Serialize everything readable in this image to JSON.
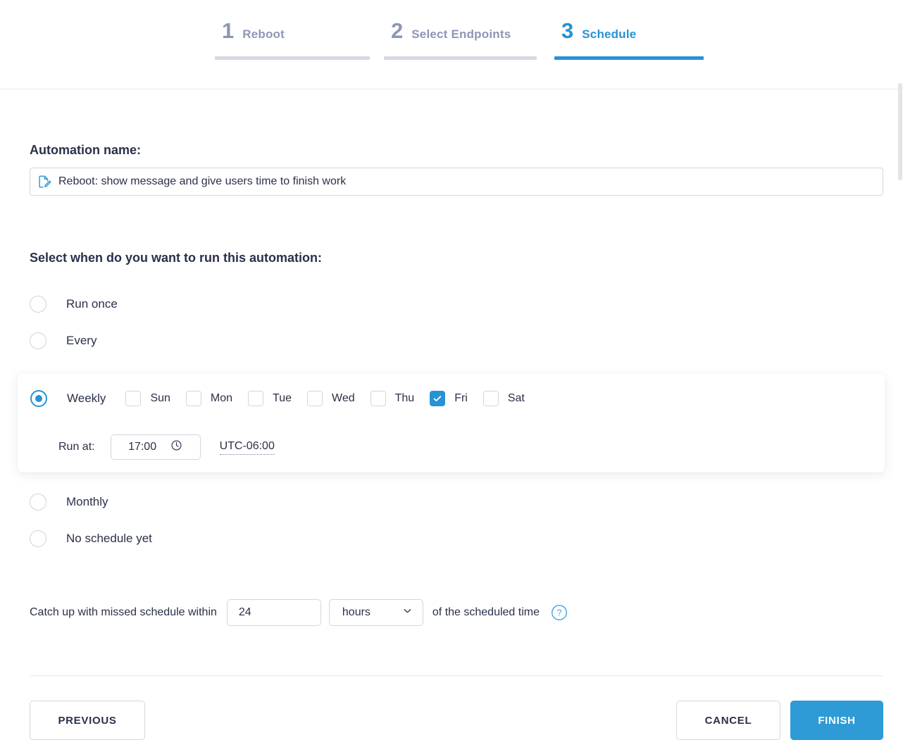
{
  "stepper": {
    "steps": [
      {
        "num": "1",
        "label": "Reboot",
        "state": "done"
      },
      {
        "num": "2",
        "label": "Select Endpoints",
        "state": "done"
      },
      {
        "num": "3",
        "label": "Schedule",
        "state": "active"
      }
    ],
    "active_color": "#2693d4",
    "inactive_color": "#8e96b4"
  },
  "form": {
    "name_label": "Automation name:",
    "name_value": "Reboot: show message and give users time to finish work",
    "name_icon": "document-edit-icon",
    "section_title": "Select when do you want to run this automation:"
  },
  "schedule": {
    "options": [
      {
        "key": "run_once",
        "label": "Run once",
        "selected": false
      },
      {
        "key": "every",
        "label": "Every",
        "selected": false
      },
      {
        "key": "weekly",
        "label": "Weekly",
        "selected": true
      },
      {
        "key": "monthly",
        "label": "Monthly",
        "selected": false
      },
      {
        "key": "no_schedule",
        "label": "No schedule yet",
        "selected": false
      }
    ],
    "weekly": {
      "label": "Weekly",
      "days": [
        {
          "label": "Sun",
          "checked": false
        },
        {
          "label": "Mon",
          "checked": false
        },
        {
          "label": "Tue",
          "checked": false
        },
        {
          "label": "Wed",
          "checked": false
        },
        {
          "label": "Thu",
          "checked": false
        },
        {
          "label": "Fri",
          "checked": true
        },
        {
          "label": "Sat",
          "checked": false
        }
      ],
      "run_at_label": "Run at:",
      "run_at_value": "17:00",
      "clock_icon": "clock-icon",
      "timezone": "UTC-06:00"
    }
  },
  "catchup": {
    "text_before": "Catch up with missed schedule within",
    "value": "24",
    "unit": "hours",
    "text_after": "of the scheduled time",
    "help_icon": "question-mark-icon"
  },
  "footer": {
    "previous": "PREVIOUS",
    "cancel": "CANCEL",
    "finish": "FINISH"
  },
  "colors": {
    "accent": "#2693d4",
    "primary_button": "#2e9bd6",
    "text": "#2b3049",
    "muted": "#8e96b4",
    "border": "#d3d6de"
  }
}
